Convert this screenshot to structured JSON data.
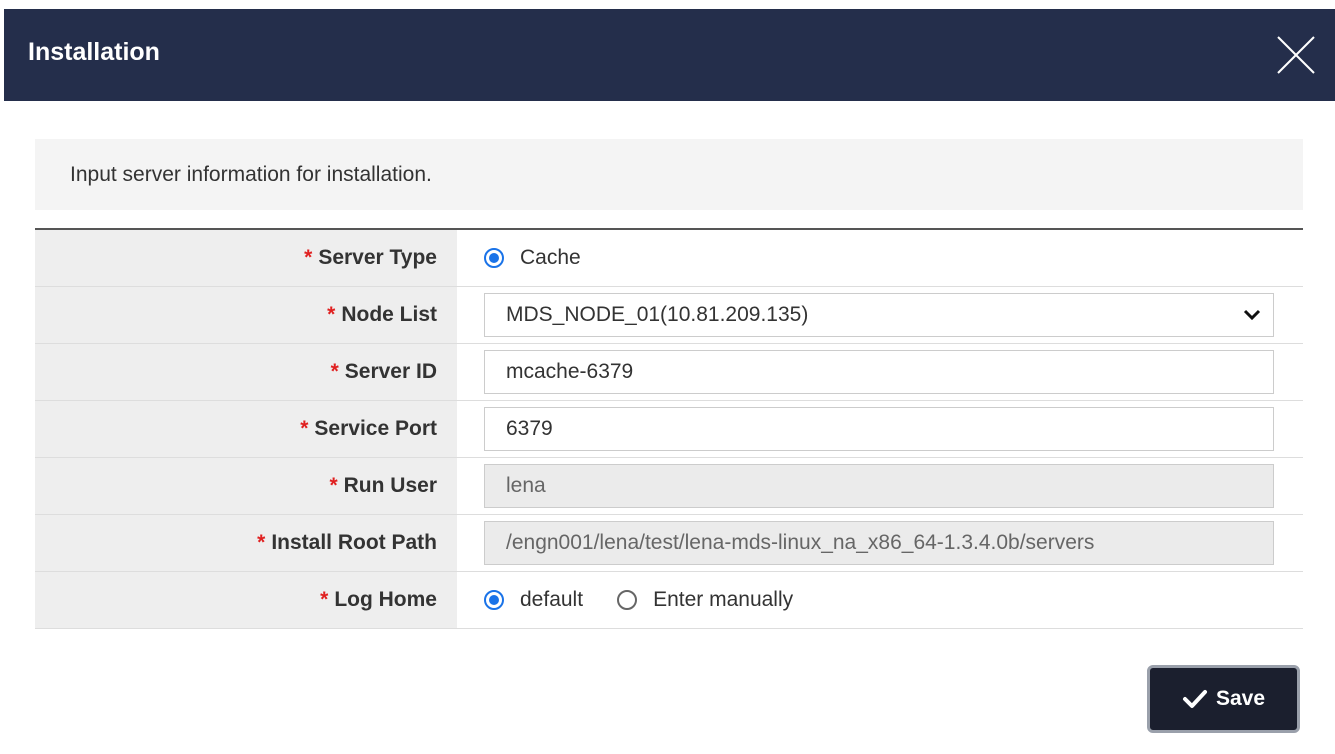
{
  "dialog": {
    "title": "Installation",
    "close_icon": "close-icon"
  },
  "info": {
    "text": "Input server information for installation."
  },
  "form": {
    "server_type": {
      "label": "Server Type",
      "options": [
        {
          "label": "Cache",
          "checked": true
        }
      ]
    },
    "node_list": {
      "label": "Node List",
      "value": "MDS_NODE_01(10.81.209.135)"
    },
    "server_id": {
      "label": "Server ID",
      "value": "mcache-6379"
    },
    "service_port": {
      "label": "Service Port",
      "value": "6379"
    },
    "run_user": {
      "label": "Run User",
      "value": "lena"
    },
    "install_root_path": {
      "label": "Install Root Path",
      "value": "/engn001/lena/test/lena-mds-linux_na_x86_64-1.3.4.0b/servers"
    },
    "log_home": {
      "label": "Log Home",
      "options": [
        {
          "label": "default",
          "checked": true
        },
        {
          "label": "Enter manually",
          "checked": false
        }
      ]
    },
    "required_mark": "*"
  },
  "actions": {
    "save_label": "Save"
  },
  "colors": {
    "header_bg": "#242e4b",
    "required": "#e02020",
    "radio_checked": "#1a73e8",
    "save_bg": "#1b1f2e"
  }
}
